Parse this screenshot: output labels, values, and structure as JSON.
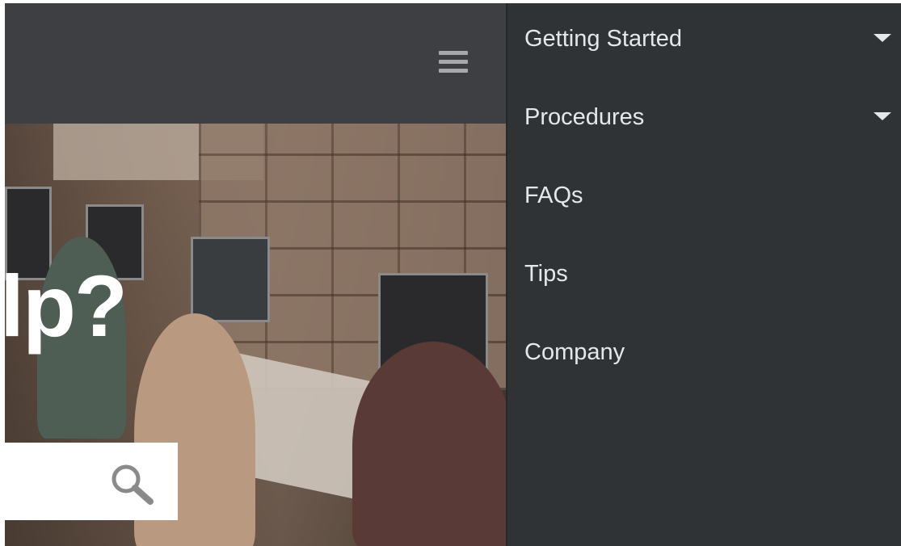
{
  "hero": {
    "title": "lp?",
    "search": {
      "placeholder": ""
    }
  },
  "nav": {
    "items": [
      {
        "label": "Getting Started",
        "has_submenu": true
      },
      {
        "label": "Procedures",
        "has_submenu": true
      },
      {
        "label": "FAQs",
        "has_submenu": false
      },
      {
        "label": "Tips",
        "has_submenu": false
      },
      {
        "label": "Company",
        "has_submenu": false
      }
    ]
  },
  "icons": {
    "menu": "hamburger-icon",
    "search": "search-icon",
    "submenu": "caret-down-icon"
  },
  "colors": {
    "header": "#3d3f43",
    "nav_background": "#303336",
    "nav_text": "#e6e7e8",
    "hamburger": "#a6a8ab"
  }
}
